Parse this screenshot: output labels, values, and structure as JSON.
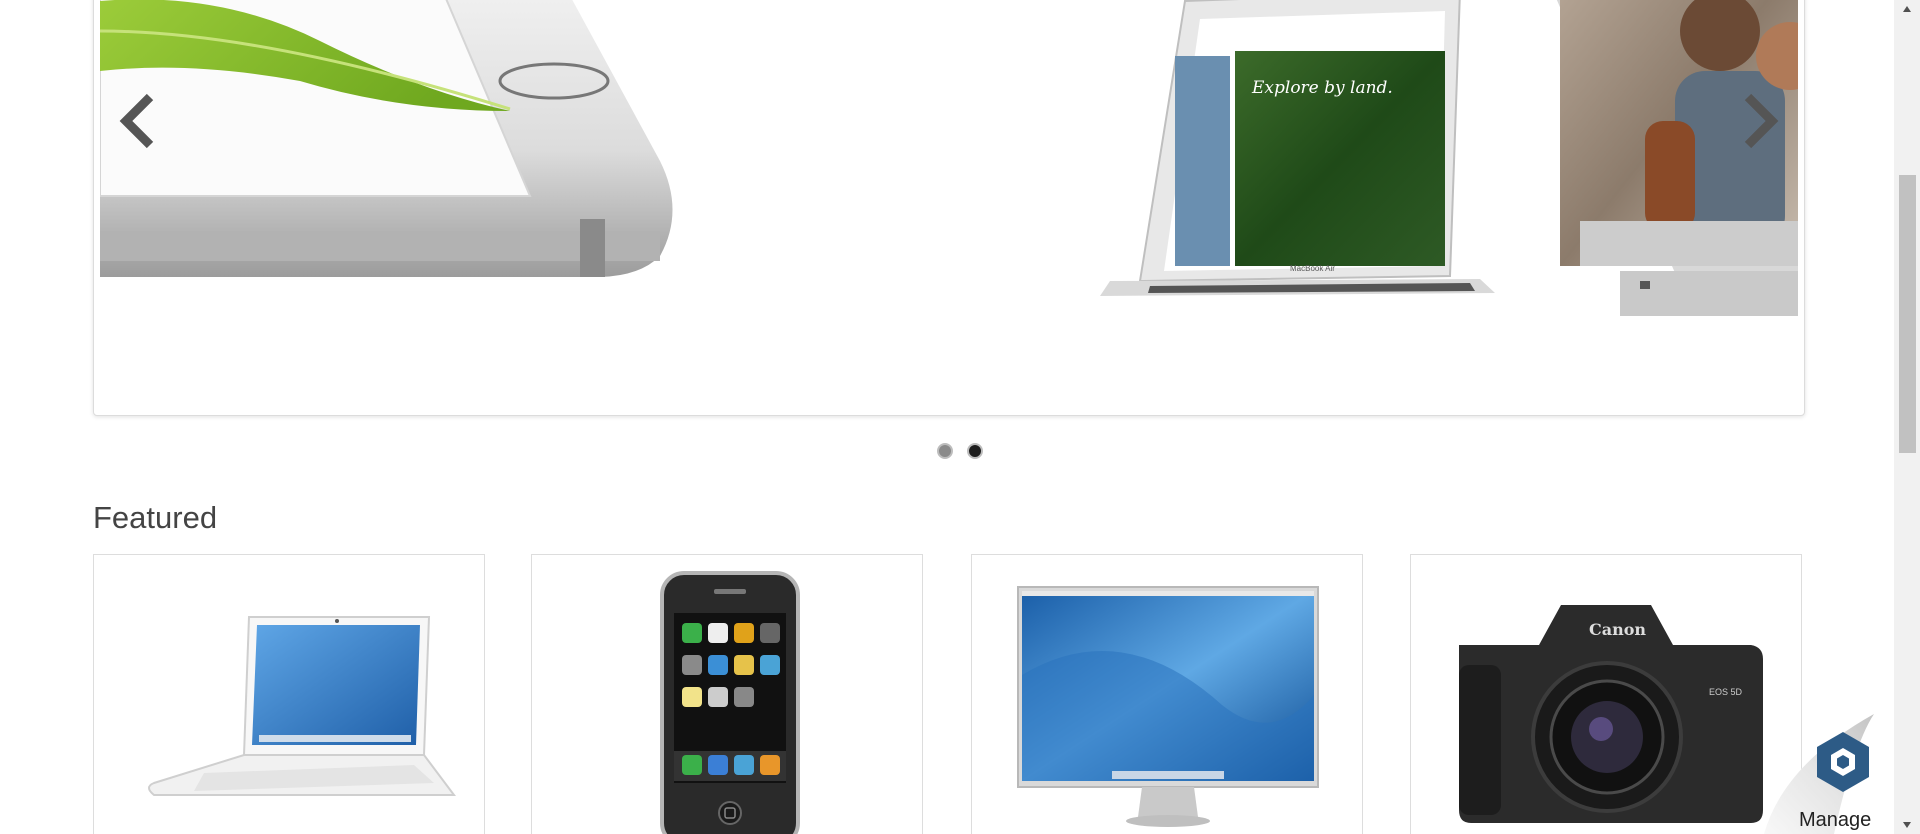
{
  "carousel": {
    "prev_arrow_icon": "chevron-left-icon",
    "next_arrow_icon": "chevron-right-icon",
    "slide_description": "product-banner",
    "laptop_screen_text": "Explore by land.",
    "laptop_model_text": "MacBook Air",
    "dots": [
      {
        "state": "inactive"
      },
      {
        "state": "active"
      }
    ]
  },
  "featured": {
    "title": "Featured",
    "products": [
      {
        "image": "white-laptop"
      },
      {
        "image": "smartphone"
      },
      {
        "image": "widescreen-monitor"
      },
      {
        "image": "dslr-camera",
        "brand_text": "Canon",
        "model_text": "EOS 5D"
      }
    ]
  },
  "manage_widget": {
    "label": "Manage",
    "icon": "hexagon-logo-icon"
  },
  "colors": {
    "heading": "#444444",
    "card_border": "#dddddd",
    "dot_active": "#1e1e1e",
    "dot_inactive": "#8a8a8a",
    "manage_icon": "#2d5b86"
  }
}
